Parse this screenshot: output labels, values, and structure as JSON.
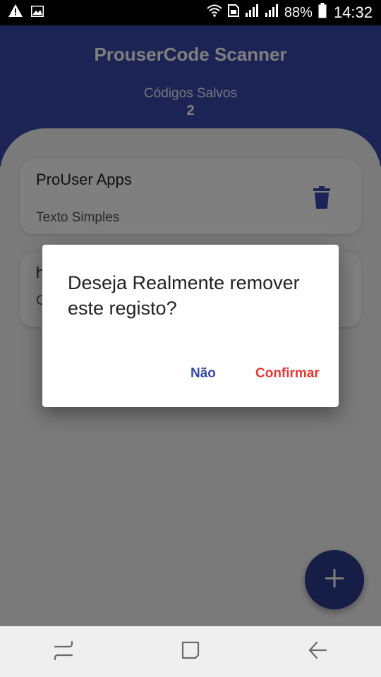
{
  "status_bar": {
    "battery": "88%",
    "time": "14:32",
    "icons": [
      "warning-icon",
      "image-icon",
      "wifi-icon",
      "sim-icon",
      "signal-icon",
      "signal-icon-2",
      "battery-icon"
    ]
  },
  "header": {
    "title": "ProuserCode Scanner",
    "saved_label": "Códigos Salvos",
    "saved_count": "2",
    "background": "#3849ab"
  },
  "records": [
    {
      "title": "ProUser Apps",
      "subtitle": "Texto Simples"
    },
    {
      "title": "h",
      "subtitle": "C"
    }
  ],
  "dialog": {
    "message": "Deseja Realmente remover este registo?",
    "cancel_label": "Não",
    "confirm_label": "Confirmar"
  },
  "colors": {
    "primary": "#3849ab",
    "danger": "#e53935",
    "fab": "#2d3a8c"
  },
  "fab": {
    "icon": "plus-icon"
  },
  "nav_bar": {
    "icons": [
      "recents-icon",
      "home-icon",
      "back-icon"
    ]
  }
}
